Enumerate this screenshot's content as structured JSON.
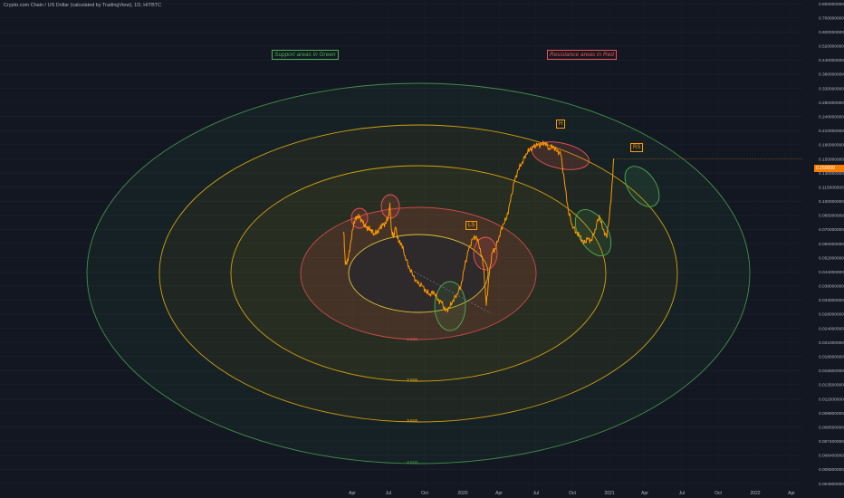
{
  "header": {
    "title": "Crypto.com Chain / US Dollar (calculated by TradingView), 1D, HITBTC"
  },
  "annotations": {
    "support": "Support areas in Green",
    "resistance": "Resistance areas in Red",
    "left_shoulder": "LS",
    "head": "H",
    "right_shoulder": "RS"
  },
  "colors": {
    "background": "#131722",
    "price_line": "#ff9800",
    "support": "#4caf50",
    "resistance": "#ef5350",
    "fib_inner": "#ffeb3b",
    "fib_outer": "#ffc107",
    "axis_text": "#b2b5be",
    "current_price": "#f57c00"
  },
  "fib_levels": [
    "1.618",
    "2.618",
    "3.618",
    "4.618"
  ],
  "chart_data": {
    "type": "line",
    "series": [
      {
        "x": [
          "2019-03-01",
          "2019-03-05",
          "2019-03-12",
          "2019-03-20",
          "2019-03-28",
          "2019-04-05",
          "2019-04-12",
          "2019-04-20",
          "2019-04-28",
          "2019-05-05",
          "2019-05-12",
          "2019-05-20",
          "2019-05-28",
          "2019-06-05",
          "2019-06-12",
          "2019-06-20",
          "2019-06-28",
          "2019-07-01",
          "2019-07-05",
          "2019-07-10",
          "2019-07-16",
          "2019-07-24",
          "2019-08-01",
          "2019-08-10",
          "2019-08-20",
          "2019-09-01",
          "2019-09-12",
          "2019-09-24",
          "2019-10-05",
          "2019-10-15",
          "2019-10-25",
          "2019-11-05",
          "2019-11-15",
          "2019-11-25",
          "2019-12-05",
          "2019-12-15",
          "2019-12-25",
          "2020-01-05",
          "2020-01-15",
          "2020-01-25",
          "2020-02-05",
          "2020-02-15",
          "2020-02-25",
          "2020-03-05",
          "2020-03-12",
          "2020-03-20",
          "2020-03-28",
          "2020-04-05",
          "2020-04-15",
          "2020-04-25",
          "2020-05-05",
          "2020-05-15",
          "2020-05-25",
          "2020-06-05",
          "2020-06-15",
          "2020-06-25",
          "2020-07-05",
          "2020-07-15",
          "2020-07-25",
          "2020-08-05",
          "2020-08-15",
          "2020-08-25",
          "2020-09-05",
          "2020-09-15",
          "2020-09-25",
          "2020-10-05",
          "2020-10-15",
          "2020-10-25",
          "2020-11-05",
          "2020-11-15",
          "2020-11-25",
          "2020-12-05",
          "2020-12-15",
          "2020-12-25",
          "2021-01-05",
          "2021-01-15",
          "2021-01-25",
          "2021-02-05",
          "2021-02-12"
        ],
        "values": [
          0.068,
          0.048,
          0.05,
          0.062,
          0.078,
          0.084,
          0.083,
          0.077,
          0.072,
          0.071,
          0.07,
          0.067,
          0.068,
          0.071,
          0.074,
          0.076,
          0.085,
          0.098,
          0.07,
          0.064,
          0.072,
          0.061,
          0.06,
          0.053,
          0.047,
          0.042,
          0.039,
          0.038,
          0.036,
          0.035,
          0.036,
          0.033,
          0.032,
          0.029,
          0.03,
          0.033,
          0.035,
          0.038,
          0.047,
          0.056,
          0.063,
          0.065,
          0.057,
          0.047,
          0.031,
          0.043,
          0.055,
          0.057,
          0.065,
          0.075,
          0.082,
          0.1,
          0.12,
          0.135,
          0.145,
          0.16,
          0.17,
          0.175,
          0.178,
          0.18,
          0.185,
          0.172,
          0.177,
          0.165,
          0.16,
          0.12,
          0.09,
          0.075,
          0.068,
          0.065,
          0.06,
          0.063,
          0.062,
          0.07,
          0.085,
          0.07,
          0.064,
          0.1,
          0.15
        ]
      }
    ],
    "current_price": "0.150000",
    "y_ticks": [
      "0.850000000",
      "0.700000000",
      "0.600000000",
      "0.520000000",
      "0.440000000",
      "0.380000000",
      "0.330000000",
      "0.280000000",
      "0.240000000",
      "0.210000000",
      "0.180000000",
      "0.150000000",
      "0.130000000",
      "0.115000000",
      "0.100000000",
      "0.085000000",
      "0.070000000",
      "0.060000000",
      "0.052000000",
      "0.044000000",
      "0.038000000",
      "0.033000000",
      "0.028000000",
      "0.024000000",
      "0.021000000",
      "0.018000000",
      "0.015500000",
      "0.013500000",
      "0.011500000",
      "0.009900000",
      "0.008500000",
      "0.007400000",
      "0.006400000",
      "0.005500000",
      "0.004800000"
    ],
    "x_ticks": [
      "Apr",
      "Jul",
      "Oct",
      "2020",
      "Apr",
      "Jul",
      "Oct",
      "2021",
      "Apr",
      "Jul",
      "Oct",
      "2022",
      "Apr"
    ],
    "ylim": [
      0.0048,
      0.85
    ],
    "log_scale": true,
    "grid": true
  }
}
